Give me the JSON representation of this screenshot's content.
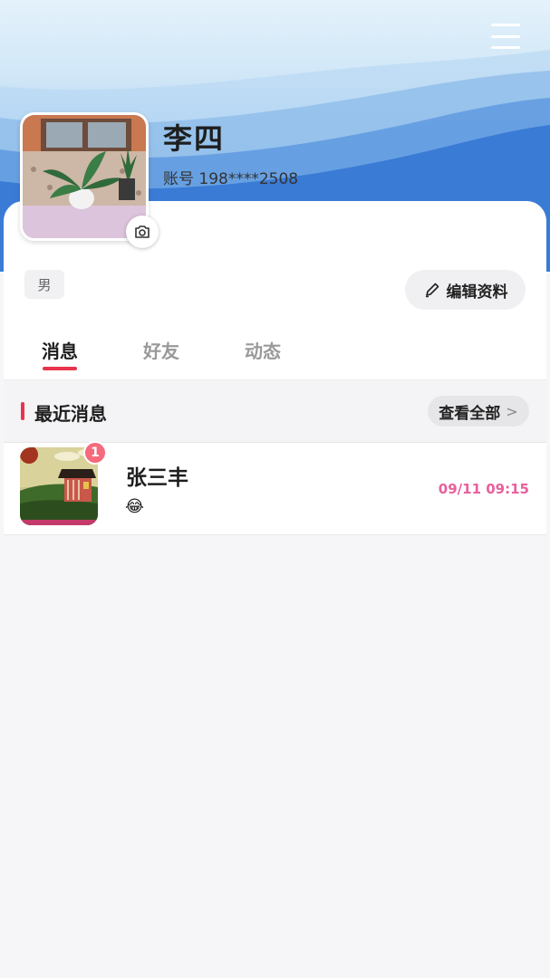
{
  "profile": {
    "name": "李四",
    "account": "账号 198****2508",
    "gender": "男",
    "edit_label": "编辑资料"
  },
  "tabs": [
    {
      "label": "消息",
      "active": true
    },
    {
      "label": "好友",
      "active": false
    },
    {
      "label": "动态",
      "active": false
    }
  ],
  "recent": {
    "title": "最近消息",
    "view_all_label": "查看全部",
    "view_all_chevron": ">"
  },
  "messages": [
    {
      "name": "张三丰",
      "preview": "😂",
      "time": "09/11 09:15",
      "unread": "1"
    }
  ],
  "icons": {
    "menu": "menu-icon",
    "camera": "camera-icon",
    "edit": "pencil-icon",
    "chevron": "chevron-right-icon"
  },
  "colors": {
    "accent": "#e8344c",
    "time": "#e8609c",
    "badge": "#f56a7c"
  }
}
